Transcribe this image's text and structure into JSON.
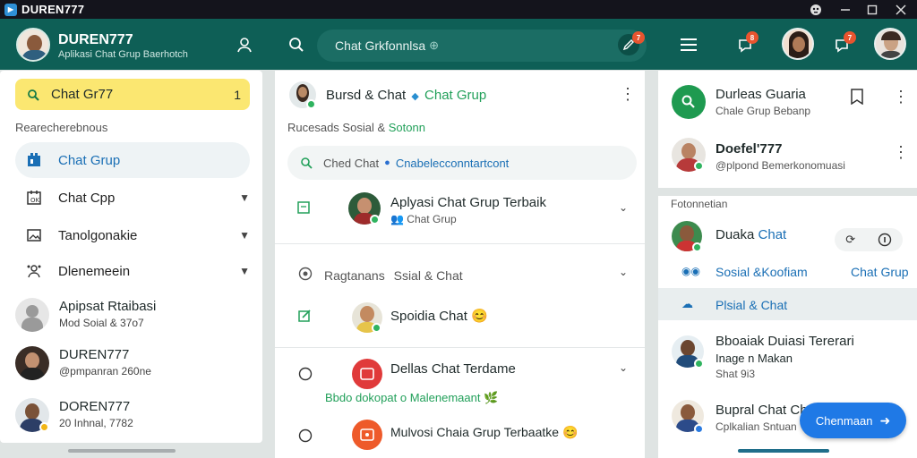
{
  "window": {
    "title": "DUREN777"
  },
  "header": {
    "name": "DUREN777",
    "subtitle": "Aplikasi Chat Grup Baerhotch",
    "search_text": "Chat Grkfonnlsa",
    "badges": [
      "7",
      "8",
      "7"
    ]
  },
  "sidebar": {
    "highlight_chip": "Chat Gr77",
    "highlight_count": "1",
    "section_label": "Rearecherebnous",
    "nav": [
      {
        "label": "Chat Grup"
      },
      {
        "label": "Chat Cpp"
      },
      {
        "label": "Tanolgonakie"
      },
      {
        "label": "Dlenemeein"
      }
    ],
    "contacts": [
      {
        "name": "Apipsat Rtaibasi",
        "sub": "Mod Soial & 37o7"
      },
      {
        "name": "DUREN777",
        "sub": "@pmpanran 260ne"
      },
      {
        "name": "DOREN777",
        "sub": "20 Inhnal, 7782"
      }
    ]
  },
  "center": {
    "title_a": "Bursd & Chat",
    "title_b": "Chat Grup",
    "subtitle_a": "Rucesads Sosial &",
    "subtitle_b": "Sotonn",
    "search_a": "Ched Chat",
    "search_b": "Cnabelecconntartcont",
    "items": [
      {
        "title": "Aplyasi Chat Grup Terbaik",
        "sub": "Chat Grup"
      },
      {
        "title": "Ragtanans",
        "title2": "Ssial & Chat"
      },
      {
        "title": "Spoidia Chat",
        "emoji": "😊"
      },
      {
        "title": "Dellas Chat Terdame",
        "sub": "Bbdo dokopat o Malenemaant"
      },
      {
        "title": "Mulvosi Chaia Grup Terbaatke",
        "emoji": "😊"
      }
    ]
  },
  "right": {
    "card1": {
      "title": "Durleas Guaria",
      "sub": "Chale Grup Bebanp"
    },
    "card2": {
      "title": "Doefel'777",
      "sub": "@plpond Bemerkonomuasi"
    },
    "section_label": "Fotonnetian",
    "row1": {
      "name_a": "Duaka",
      "name_b": "Chat"
    },
    "row2": {
      "label_a": "Sosial &Koofiam",
      "label_b": "Chat Grup"
    },
    "row3": {
      "label": "Plsial & Chat"
    },
    "row4": {
      "title": "Bboaiak Duiasi Tererari",
      "line2": "Inage n Makan",
      "line3": "Shat 9i3"
    },
    "row5": {
      "title": "Bupral Chat Ch",
      "sub": "Cplkalian Sntuan"
    },
    "fab_label": "Chenmaan"
  }
}
